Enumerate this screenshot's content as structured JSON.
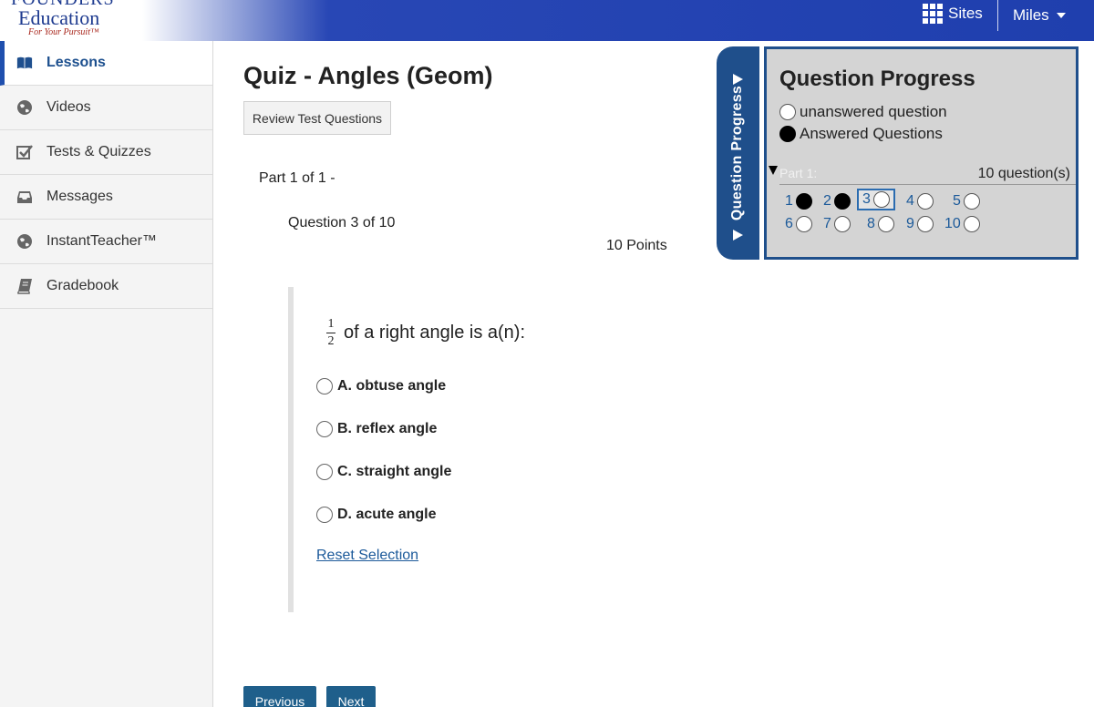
{
  "header": {
    "logo": {
      "line1": "FOUNDERS",
      "line2": "Education",
      "tagline": "For Your Pursuit™"
    },
    "sites_label": "Sites",
    "user_label": "Miles"
  },
  "sidebar": {
    "items": [
      {
        "label": "Lessons",
        "icon": "book-icon",
        "active": true
      },
      {
        "label": "Videos",
        "icon": "globe-icon"
      },
      {
        "label": "Tests & Quizzes",
        "icon": "checkbox-icon"
      },
      {
        "label": "Messages",
        "icon": "inbox-icon"
      },
      {
        "label": "InstantTeacher™",
        "icon": "globe-icon"
      },
      {
        "label": "Gradebook",
        "icon": "notebook-icon"
      }
    ]
  },
  "main": {
    "title": "Quiz - Angles (Geom)",
    "review_button": "Review Test Questions",
    "part_label": "Part 1 of 1 -",
    "question_label": "Question 3 of 10",
    "points_label": "10 Points",
    "question": {
      "fraction_num": "1",
      "fraction_den": "2",
      "text": "of a right angle is a(n):"
    },
    "options": [
      {
        "label": "A. obtuse angle"
      },
      {
        "label": "B. reflex angle"
      },
      {
        "label": "C. straight angle"
      },
      {
        "label": "D. acute angle"
      }
    ],
    "reset_label": "Reset Selection",
    "previous_label": "Previous",
    "next_label": "Next"
  },
  "progress": {
    "tab_label": "Question Progress",
    "title": "Question Progress",
    "legend_unanswered": "unanswered question",
    "legend_answered": "Answered Questions",
    "part_label": "Part 1:",
    "part_count": "10 question(s)",
    "questions": [
      {
        "n": "1",
        "answered": true
      },
      {
        "n": "2",
        "answered": true
      },
      {
        "n": "3",
        "answered": false,
        "current": true
      },
      {
        "n": "4",
        "answered": false
      },
      {
        "n": "5",
        "answered": false
      },
      {
        "n": "6",
        "answered": false
      },
      {
        "n": "7",
        "answered": false
      },
      {
        "n": "8",
        "answered": false
      },
      {
        "n": "9",
        "answered": false
      },
      {
        "n": "10",
        "answered": false
      }
    ]
  },
  "colors": {
    "brand_blue": "#1f3fae",
    "panel_blue": "#1f4f8b",
    "link": "#1c5a9a"
  }
}
